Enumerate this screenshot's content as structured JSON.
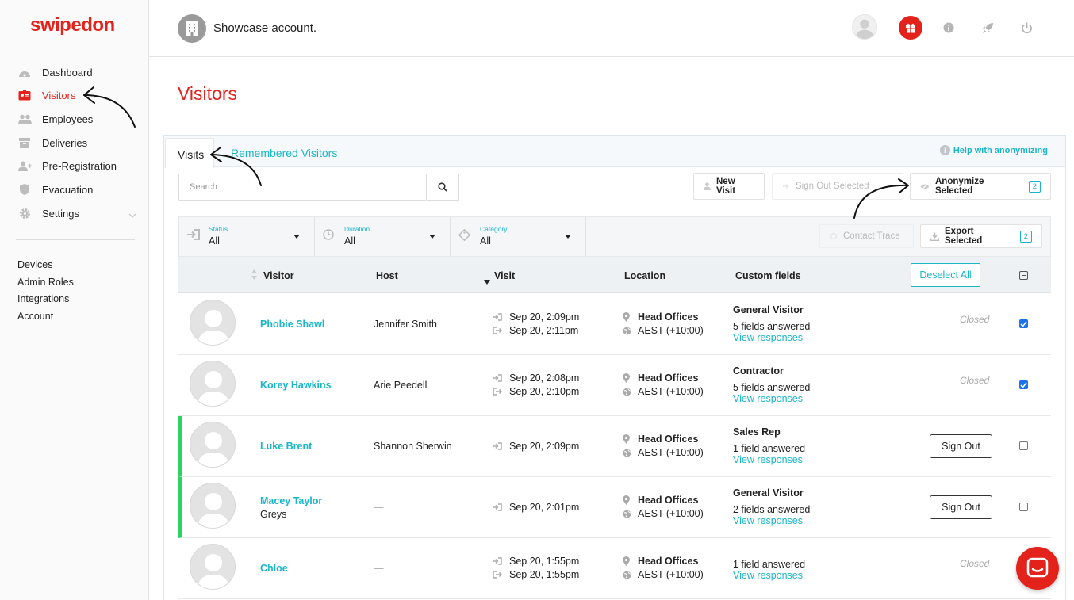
{
  "brand": {
    "logo_text": "swipedon",
    "accent_color": "#e3221c",
    "link_color": "#19b6c8",
    "active_row_color": "#2ed162"
  },
  "sidebar": {
    "items": [
      {
        "label": "Dashboard",
        "icon": "dashboard-icon"
      },
      {
        "label": "Visitors",
        "icon": "visitors-badge-icon",
        "active": true
      },
      {
        "label": "Employees",
        "icon": "employees-icon"
      },
      {
        "label": "Deliveries",
        "icon": "deliveries-icon"
      },
      {
        "label": "Pre-Registration",
        "icon": "pre-registration-icon"
      },
      {
        "label": "Evacuation",
        "icon": "evacuation-shield-icon"
      },
      {
        "label": "Settings",
        "icon": "settings-gear-icon"
      }
    ],
    "links": [
      "Devices",
      "Admin Roles",
      "Integrations",
      "Account"
    ]
  },
  "topbar": {
    "account_name": "Showcase account."
  },
  "page": {
    "title": "Visitors"
  },
  "tabs": {
    "visits": "Visits",
    "remembered": "Remembered Visitors",
    "help": "Help with anonymizing"
  },
  "toolbar": {
    "search_placeholder": "Search",
    "new_visit": "New Visit",
    "sign_out_selected": "Sign Out Selected",
    "anonymize_selected": "Anonymize Selected",
    "anonymize_count": "2",
    "contact_trace": "Contact Trace",
    "export_selected": "Export Selected",
    "export_count": "2"
  },
  "filters": [
    {
      "label": "Status",
      "value": "All"
    },
    {
      "label": "Duration",
      "value": "All"
    },
    {
      "label": "Category",
      "value": "All"
    }
  ],
  "columns": {
    "visitor": "Visitor",
    "host": "Host",
    "visit": "Visit",
    "location": "Location",
    "custom_fields": "Custom fields",
    "deselect_all": "Deselect All"
  },
  "rows": [
    {
      "name": "Phobie Shawl",
      "company": "",
      "host": "Jennifer Smith",
      "sign_in": "Sep 20, 2:09pm",
      "sign_out": "Sep 20, 2:11pm",
      "location": "Head Offices",
      "timezone": "AEST (+10:00)",
      "category": "General Visitor",
      "fields": "5 fields answered",
      "view": "View responses",
      "status": "Closed",
      "checked": true,
      "active": false
    },
    {
      "name": "Korey Hawkins",
      "company": "",
      "host": "Arie Peedell",
      "sign_in": "Sep 20, 2:08pm",
      "sign_out": "Sep 20, 2:10pm",
      "location": "Head Offices",
      "timezone": "AEST (+10:00)",
      "category": "Contractor",
      "fields": "5 fields answered",
      "view": "View responses",
      "status": "Closed",
      "checked": true,
      "active": false
    },
    {
      "name": "Luke Brent",
      "company": "",
      "host": "Shannon Sherwin",
      "sign_in": "Sep 20, 2:09pm",
      "sign_out": "",
      "location": "Head Offices",
      "timezone": "AEST (+10:00)",
      "category": "Sales Rep",
      "fields": "1 field answered",
      "view": "View responses",
      "status": "Sign Out",
      "checked": false,
      "active": true
    },
    {
      "name": "Macey Taylor",
      "company": "Greys",
      "host": "—",
      "sign_in": "Sep 20, 2:01pm",
      "sign_out": "",
      "location": "Head Offices",
      "timezone": "AEST (+10:00)",
      "category": "General Visitor",
      "fields": "2 fields answered",
      "view": "View responses",
      "status": "Sign Out",
      "checked": false,
      "active": true
    },
    {
      "name": "Chloe",
      "company": "",
      "host": "—",
      "sign_in": "Sep 20, 1:55pm",
      "sign_out": "Sep 20, 1:55pm",
      "location": "Head Offices",
      "timezone": "AEST (+10:00)",
      "category": "",
      "fields": "1 field answered",
      "view": "View responses",
      "status": "Closed",
      "checked": false,
      "active": false
    }
  ]
}
